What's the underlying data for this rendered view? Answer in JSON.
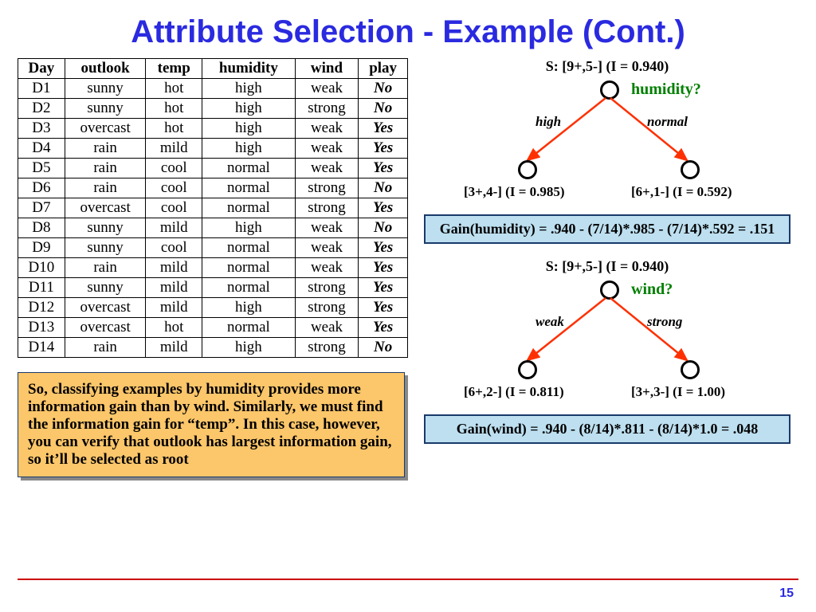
{
  "title": "Attribute Selection - Example (Cont.)",
  "page_number": "15",
  "table": {
    "headers": [
      "Day",
      "outlook",
      "temp",
      "humidity",
      "wind",
      "play"
    ],
    "rows": [
      [
        "D1",
        "sunny",
        "hot",
        "high",
        "weak",
        "No"
      ],
      [
        "D2",
        "sunny",
        "hot",
        "high",
        "strong",
        "No"
      ],
      [
        "D3",
        "overcast",
        "hot",
        "high",
        "weak",
        "Yes"
      ],
      [
        "D4",
        "rain",
        "mild",
        "high",
        "weak",
        "Yes"
      ],
      [
        "D5",
        "rain",
        "cool",
        "normal",
        "weak",
        "Yes"
      ],
      [
        "D6",
        "rain",
        "cool",
        "normal",
        "strong",
        "No"
      ],
      [
        "D7",
        "overcast",
        "cool",
        "normal",
        "strong",
        "Yes"
      ],
      [
        "D8",
        "sunny",
        "mild",
        "high",
        "weak",
        "No"
      ],
      [
        "D9",
        "sunny",
        "cool",
        "normal",
        "weak",
        "Yes"
      ],
      [
        "D10",
        "rain",
        "mild",
        "normal",
        "weak",
        "Yes"
      ],
      [
        "D11",
        "sunny",
        "mild",
        "normal",
        "strong",
        "Yes"
      ],
      [
        "D12",
        "overcast",
        "mild",
        "high",
        "strong",
        "Yes"
      ],
      [
        "D13",
        "overcast",
        "hot",
        "normal",
        "weak",
        "Yes"
      ],
      [
        "D14",
        "rain",
        "mild",
        "high",
        "strong",
        "No"
      ]
    ]
  },
  "note": "So, classifying examples by humidity provides more information gain than by wind. Similarly, we must find the information gain for “temp”. In this case, however, you can verify that outlook has largest information gain, so it’ll be selected as root",
  "tree1": {
    "root": "S: [9+,5-] (I = 0.940)",
    "split": "humidity?",
    "left_edge": "high",
    "right_edge": "normal",
    "left_leaf": "[3+,4-] (I = 0.985)",
    "right_leaf": "[6+,1-] (I = 0.592)",
    "gain": "Gain(humidity) = .940 - (7/14)*.985 - (7/14)*.592 = .151"
  },
  "tree2": {
    "root": "S: [9+,5-] (I = 0.940)",
    "split": "wind?",
    "left_edge": "weak",
    "right_edge": "strong",
    "left_leaf": "[6+,2-] (I = 0.811)",
    "right_leaf": "[3+,3-] (I = 1.00)",
    "gain": "Gain(wind) = .940 - (8/14)*.811 - (8/14)*1.0 = .048"
  }
}
